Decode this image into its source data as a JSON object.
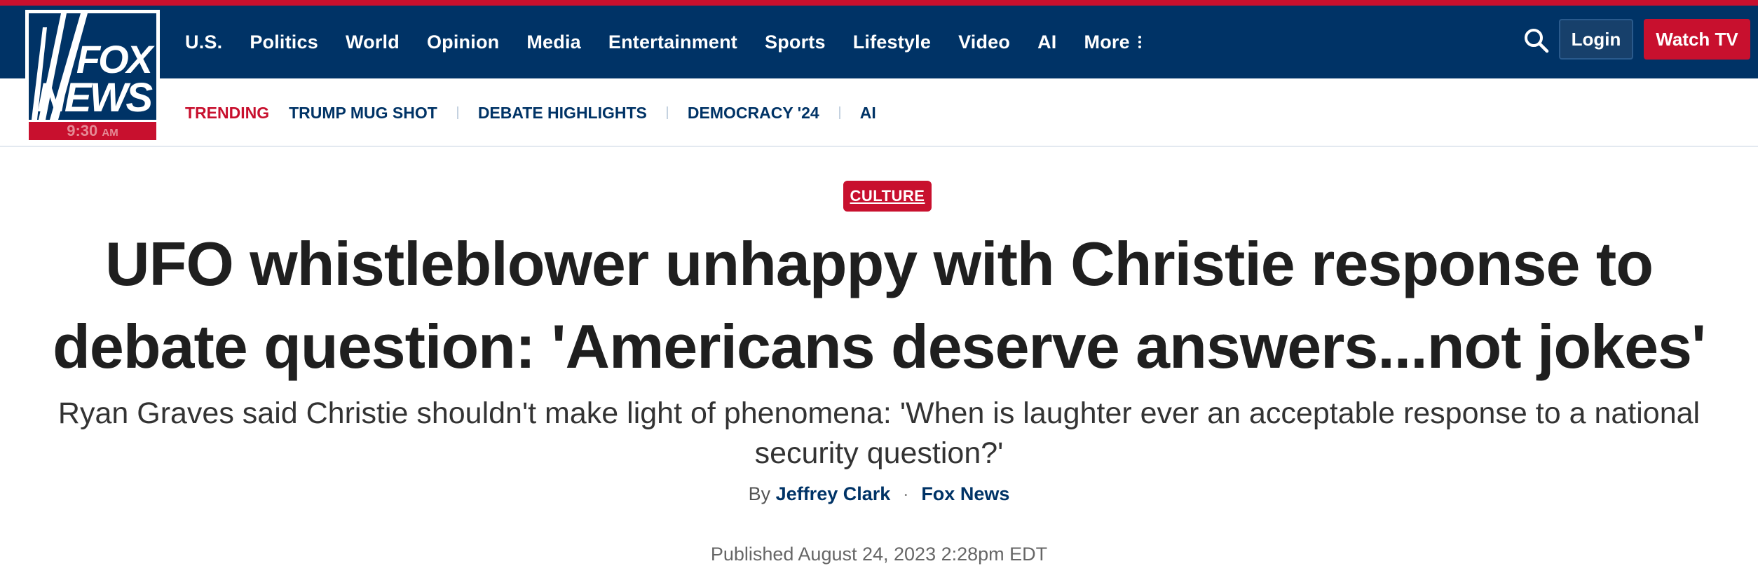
{
  "brand": {
    "logo_line1": "FOX",
    "logo_line2": "NEWS",
    "time": "9:30",
    "time_suffix": "AM",
    "colors": {
      "navy": "#003366",
      "red": "#c8102e"
    }
  },
  "nav": {
    "items": [
      "U.S.",
      "Politics",
      "World",
      "Opinion",
      "Media",
      "Entertainment",
      "Sports",
      "Lifestyle",
      "Video",
      "AI"
    ],
    "more_label": "More",
    "search_icon": "search-icon",
    "login_label": "Login",
    "watch_label": "Watch TV"
  },
  "trending": {
    "label": "TRENDING",
    "items": [
      "TRUMP MUG SHOT",
      "DEBATE HIGHLIGHTS",
      "DEMOCRACY '24",
      "AI"
    ]
  },
  "article": {
    "category": "CULTURE",
    "headline": "UFO whistleblower unhappy with Christie response to debate question: 'Americans deserve answers...not jokes'",
    "subheadline": "Ryan Graves said Christie shouldn't make light of phenomena: 'When is laughter ever an acceptable response to a national security question?'",
    "byline_prefix": "By",
    "author": "Jeffrey Clark",
    "byline_separator": "·",
    "outlet": "Fox News",
    "published": "Published August 24, 2023 2:28pm EDT"
  }
}
